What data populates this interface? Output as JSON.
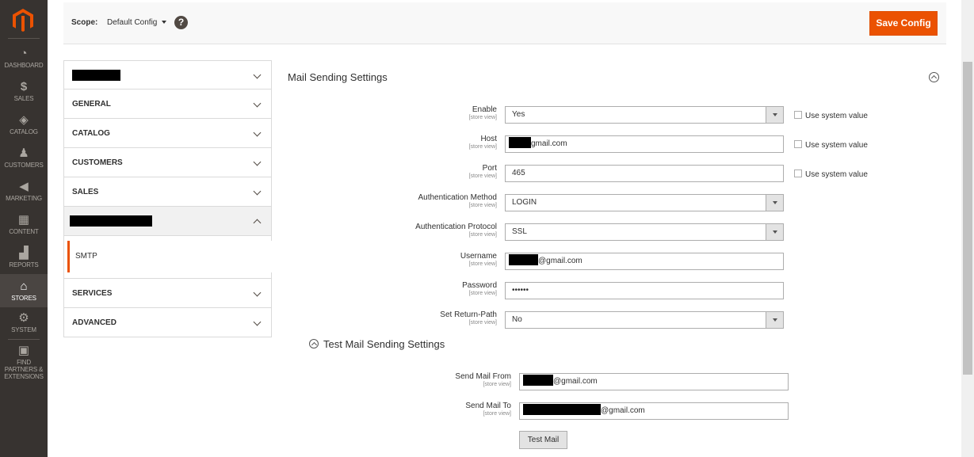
{
  "nav": {
    "items": [
      {
        "label": "DASHBOARD",
        "icon": "dashboard-icon"
      },
      {
        "label": "SALES",
        "icon": "dollar-icon"
      },
      {
        "label": "CATALOG",
        "icon": "cube-icon"
      },
      {
        "label": "CUSTOMERS",
        "icon": "person-icon"
      },
      {
        "label": "MARKETING",
        "icon": "megaphone-icon"
      },
      {
        "label": "CONTENT",
        "icon": "layout-icon"
      },
      {
        "label": "REPORTS",
        "icon": "bar-chart-icon"
      },
      {
        "label": "STORES",
        "icon": "storefront-icon"
      },
      {
        "label": "SYSTEM",
        "icon": "gear-icon"
      },
      {
        "label": "FIND PARTNERS & EXTENSIONS",
        "icon": "package-icon"
      }
    ]
  },
  "scope": {
    "label": "Scope:",
    "value": "Default Config",
    "save_label": "Save Config"
  },
  "tabs": {
    "general": "GENERAL",
    "catalog": "CATALOG",
    "customers": "CUSTOMERS",
    "sales": "SALES",
    "sub_item": "SMTP",
    "services": "SERVICES",
    "advanced": "ADVANCED"
  },
  "section": {
    "title": "Mail Sending Settings",
    "scope_note": "[store view]",
    "use_system_value": "Use system value"
  },
  "fields": {
    "enable": {
      "label": "Enable",
      "value": "Yes"
    },
    "host": {
      "label": "Host",
      "value": "gmail.com"
    },
    "port": {
      "label": "Port",
      "value": "465"
    },
    "auth_method": {
      "label": "Authentication Method",
      "value": "LOGIN"
    },
    "auth_protocol": {
      "label": "Authentication Protocol",
      "value": "SSL"
    },
    "username": {
      "label": "Username",
      "value": "@gmail.com"
    },
    "password": {
      "label": "Password",
      "value": "••••••"
    },
    "return_path": {
      "label": "Set Return-Path",
      "value": "No"
    }
  },
  "test": {
    "title": "Test Mail Sending Settings",
    "from": {
      "label": "Send Mail From",
      "value": "@gmail.com"
    },
    "to": {
      "label": "Send Mail To",
      "value": "@gmail.com"
    },
    "button": "Test Mail"
  },
  "colors": {
    "accent": "#eb5202",
    "nav_bg": "#373330"
  }
}
